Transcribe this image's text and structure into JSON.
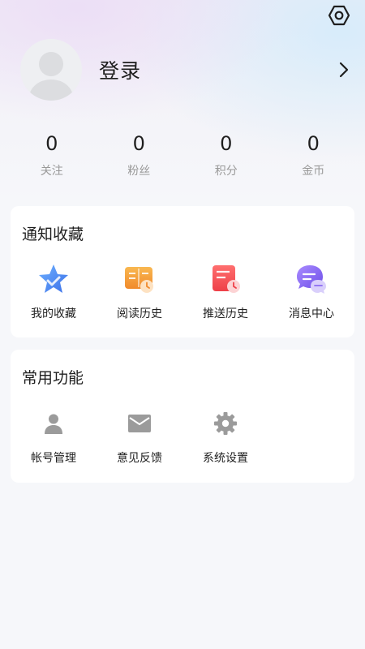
{
  "header": {
    "settings_icon": "hexagon-settings-icon",
    "login_label": "登录",
    "avatar_icon": "default-avatar-icon",
    "chevron_icon": "chevron-right-icon"
  },
  "stats": [
    {
      "value": "0",
      "label": "关注"
    },
    {
      "value": "0",
      "label": "粉丝"
    },
    {
      "value": "0",
      "label": "积分"
    },
    {
      "value": "0",
      "label": "金币"
    }
  ],
  "notify_section": {
    "title": "通知收藏",
    "items": [
      {
        "label": "我的收藏",
        "icon": "star-favorites-icon"
      },
      {
        "label": "阅读历史",
        "icon": "book-history-icon"
      },
      {
        "label": "推送历史",
        "icon": "push-history-icon"
      },
      {
        "label": "消息中心",
        "icon": "message-chat-icon"
      }
    ]
  },
  "common_section": {
    "title": "常用功能",
    "items": [
      {
        "label": "帐号管理",
        "icon": "user-account-icon"
      },
      {
        "label": "意见反馈",
        "icon": "mail-feedback-icon"
      },
      {
        "label": "系统设置",
        "icon": "gear-settings-icon"
      }
    ]
  },
  "colors": {
    "background": "#f6f7fa",
    "card": "#ffffff",
    "muted_text": "#999999",
    "icon_gray": "#9b9b9b",
    "star_blue": "#4a8af5",
    "book_orange": "#f5a442",
    "push_red": "#f2555a",
    "message_purple": "#8b6cf2"
  }
}
